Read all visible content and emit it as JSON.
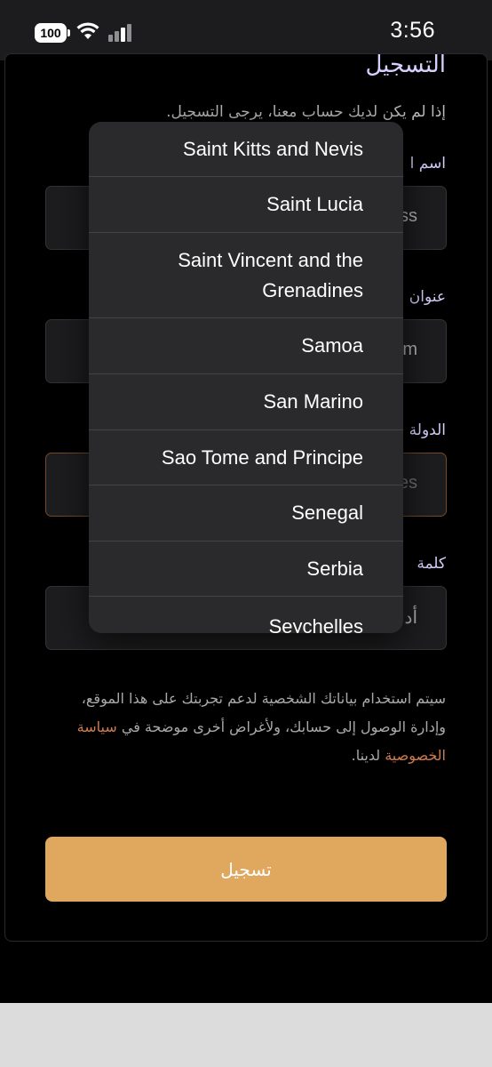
{
  "status_bar": {
    "battery": "100",
    "time": "3:56"
  },
  "form": {
    "title": "التسجيل",
    "subtitle": "إذا لم يكن لديك حساب معنا، يرجى التسجيل.",
    "fields": [
      {
        "label": "اسم ا",
        "value": "ss"
      },
      {
        "label": "عنوان",
        "value": "m"
      },
      {
        "label": "الدولة",
        "value": "es"
      },
      {
        "label": "كلمة",
        "value": "أد"
      }
    ],
    "privacy_text_before": "سيتم استخدام بياناتك الشخصية لدعم تجربتك على هذا الموقع، وإدارة الوصول إلى حسابك، ولأغراض أخرى موضحة في ",
    "privacy_link": "سياسة الخصوصية",
    "privacy_text_after": " لدينا.",
    "submit_label": "تسجيل"
  },
  "country_dropdown": {
    "options": [
      "Saint Kitts and Nevis",
      "Saint Lucia",
      "Saint Vincent and the Grenadines",
      "Samoa",
      "San Marino",
      "Sao Tome and Principe",
      "Senegal",
      "Serbia",
      "Seychelles"
    ]
  }
}
